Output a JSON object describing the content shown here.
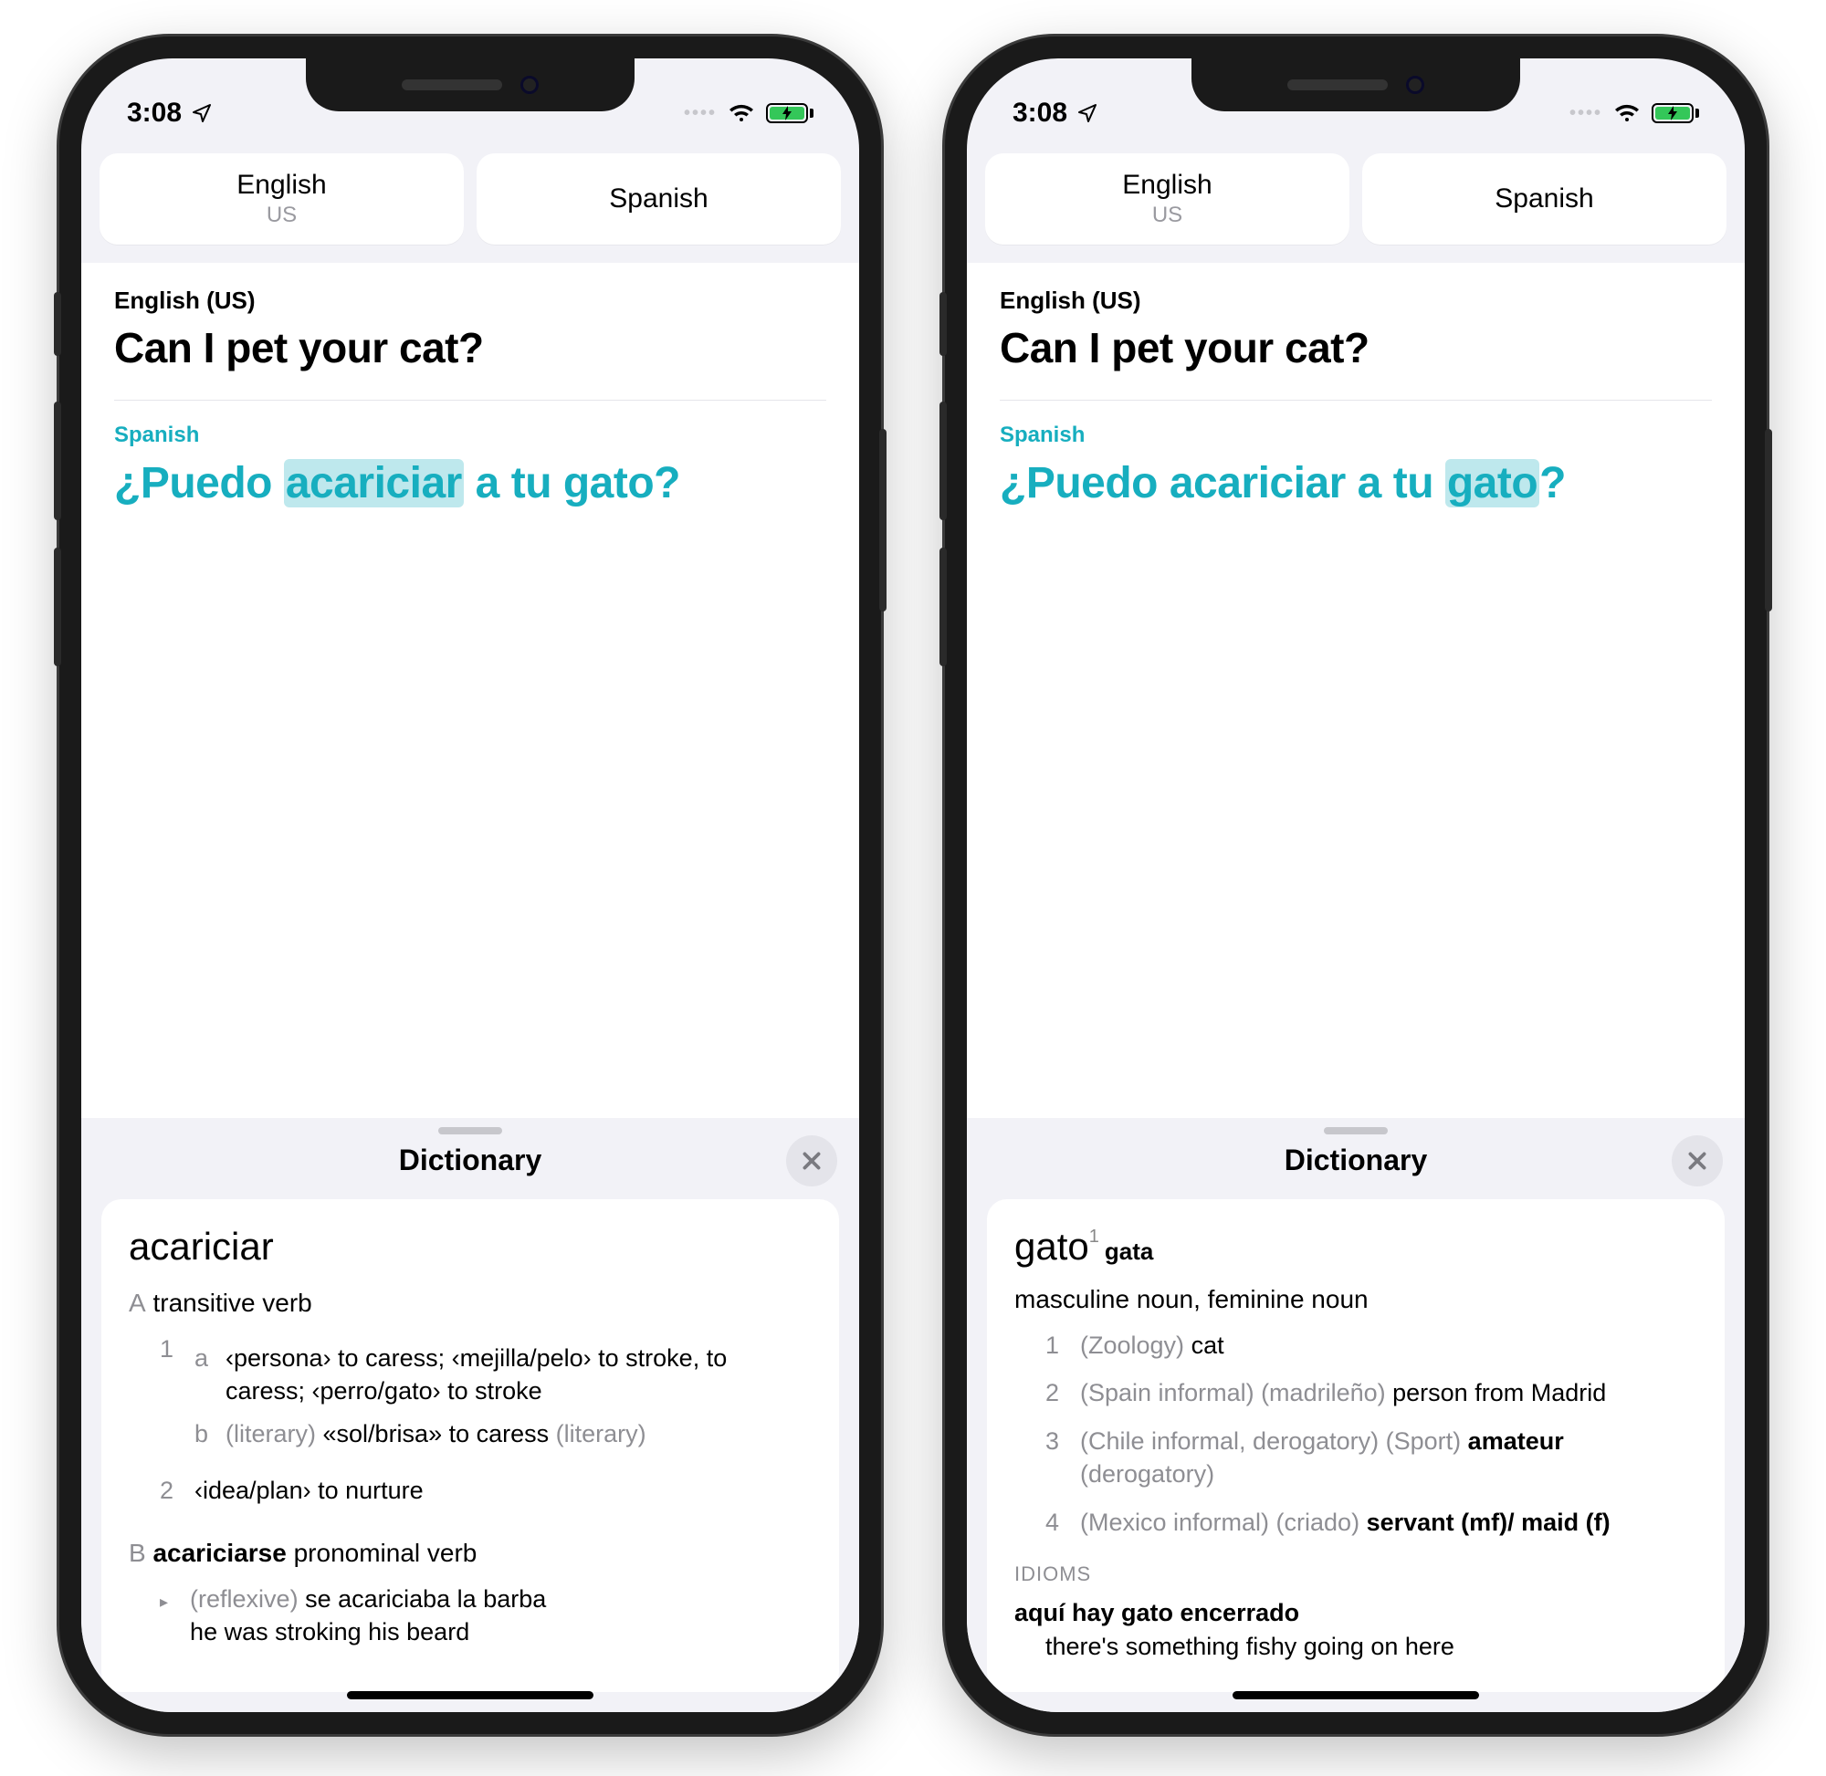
{
  "status": {
    "time": "3:08"
  },
  "langbar": {
    "source": {
      "name": "English",
      "sub": "US"
    },
    "target": {
      "name": "Spanish",
      "sub": ""
    }
  },
  "translate": {
    "srcLabel": "English (US)",
    "srcText": "Can I pet your cat?",
    "tgtLabel": "Spanish",
    "left": {
      "pre": "¿Puedo ",
      "hl": "acariciar",
      "post": " a tu gato?"
    },
    "right": {
      "pre": "¿Puedo acariciar a tu ",
      "hl": "gato",
      "post": "?"
    }
  },
  "sheet": {
    "title": "Dictionary"
  },
  "dict": {
    "left": {
      "headword": "acariciar",
      "A": {
        "letter": "A",
        "pos": "transitive verb",
        "senses": [
          {
            "num": "1",
            "subs": [
              {
                "letter": "a",
                "text": "‹persona› to caress; ‹mejilla/pelo› to stroke, to caress; ‹perro/gato› to stroke"
              },
              {
                "letter": "b",
                "pre": "(literary)",
                "text": "«sol/brisa» to caress",
                "post": "(literary)"
              }
            ]
          },
          {
            "num": "2",
            "text": "‹idea/plan› to nurture"
          }
        ]
      },
      "B": {
        "letter": "B",
        "headword": "acariciarse",
        "pos": "pronominal verb",
        "example": {
          "pre": "(reflexive)",
          "es": "se acariciaba la barba",
          "en": "he was stroking his beard"
        }
      }
    },
    "right": {
      "headword": "gato",
      "sup": "1",
      "alt": "gata",
      "posLine": "masculine noun, feminine noun",
      "senses": [
        {
          "num": "1",
          "tags": "(Zoology)",
          "def": "cat"
        },
        {
          "num": "2",
          "tags": "(Spain informal) (madrileño)",
          "def": "person from Madrid"
        },
        {
          "num": "3",
          "tags": "(Chile informal, derogatory) (Sport)",
          "def": "amateur",
          "post": "(derogatory)"
        },
        {
          "num": "4",
          "tags": "(Mexico informal) (criado)",
          "def": "servant (mf)/ maid (f)"
        }
      ],
      "idiomsHeader": "IDIOMS",
      "idiom": {
        "hw": "aquí hay gato encerrado",
        "def": "there's something fishy going on here"
      }
    }
  }
}
